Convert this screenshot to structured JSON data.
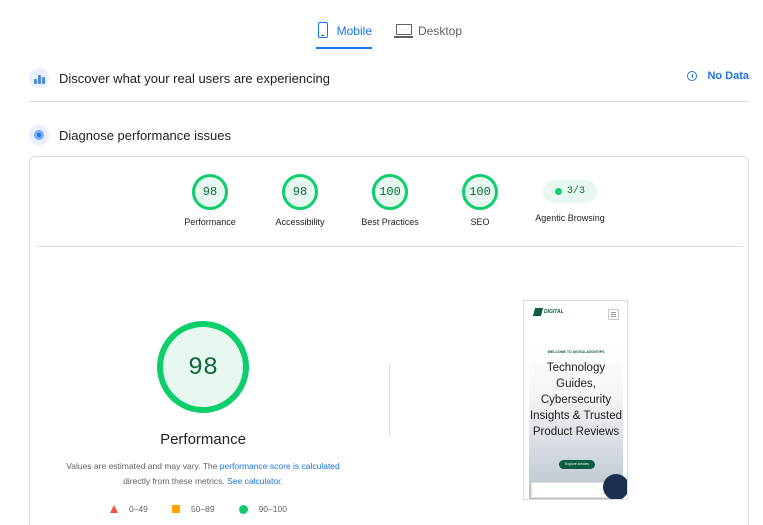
{
  "tabs": {
    "mobile": {
      "label": "Mobile",
      "icon": "phone-icon",
      "active": true
    },
    "desktop": {
      "label": "Desktop",
      "icon": "desktop-icon",
      "active": false
    }
  },
  "field_data": {
    "title": "Discover what your real users are experiencing",
    "status_label": "No Data",
    "icon": "crux-bars-icon"
  },
  "diagnose": {
    "title": "Diagnose performance issues",
    "icon": "lab-target-icon"
  },
  "categories": [
    {
      "label": "Performance",
      "score": "98",
      "color": "#0cce6b"
    },
    {
      "label": "Accessibility",
      "score": "98",
      "color": "#0cce6b"
    },
    {
      "label": "Best Practices",
      "score": "100",
      "color": "#0cce6b"
    },
    {
      "label": "SEO",
      "score": "100",
      "color": "#0cce6b"
    },
    {
      "label": "Agentic Browsing",
      "score": "3/3",
      "color": "#0cce6b"
    }
  ],
  "main_score": {
    "value": "98",
    "label": "Performance",
    "note_prefix": "Values are estimated and may vary. The ",
    "note_link1": "performance score is calculated",
    "note_mid": " directly from these metrics. ",
    "note_link2": "See calculator."
  },
  "legend": [
    {
      "range": "0–49",
      "shape": "triangle",
      "color": "#ff4e42"
    },
    {
      "range": "50–89",
      "shape": "square",
      "color": "#ffa400"
    },
    {
      "range": "90–100",
      "shape": "circle",
      "color": "#0cce6b"
    }
  ],
  "screenshot": {
    "logo_text": "DIGITAL",
    "kicker": "WELCOME TO DIGITALADONTIPS",
    "headline": "Technology Guides, Cybersecurity Insights & Trusted Product Reviews",
    "cta": "Explore Articles"
  }
}
